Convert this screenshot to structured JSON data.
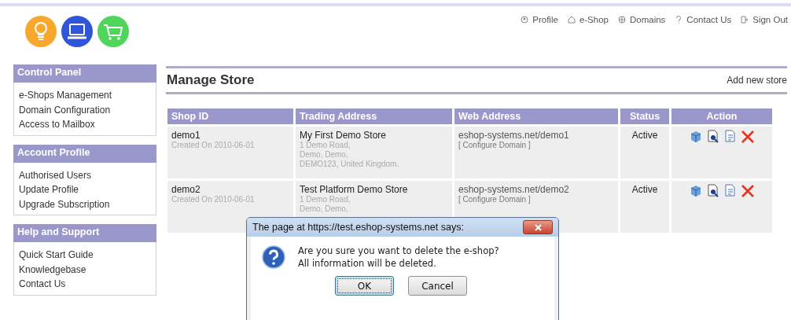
{
  "nav_links": [
    {
      "label": "Profile"
    },
    {
      "label": "e-Shop"
    },
    {
      "label": "Domains"
    },
    {
      "label": "Contact Us"
    },
    {
      "label": "Sign Out"
    }
  ],
  "sidebar": {
    "sections": [
      {
        "title": "Control Panel",
        "items": [
          "e-Shops Management",
          "Domain Configuration",
          "Access to Mailbox"
        ]
      },
      {
        "title": "Account Profile",
        "items": [
          "Authorised Users",
          "Update Profile",
          "Upgrade Subscription"
        ]
      },
      {
        "title": "Help and Support",
        "items": [
          "Quick Start Guide",
          "Knowledgebase",
          "Contact Us"
        ]
      }
    ]
  },
  "main": {
    "title": "Manage Store",
    "add_link": "Add new store",
    "table": {
      "columns": [
        "Shop ID",
        "Trading Address",
        "Web Address",
        "Status",
        "Action"
      ],
      "rows": [
        {
          "shop_id": "demo1",
          "created": "Created On 2010-06-01",
          "trading_name": "My First Demo Store",
          "address_lines": [
            "1 Demo Road,",
            "Demo, Demo,",
            "DEMO123, United Kingdom."
          ],
          "web_address": "eshop-systems.net/demo1",
          "configure_link": "[ Configure Domain ]",
          "status": "Active"
        },
        {
          "shop_id": "demo2",
          "created": "Created On 2010-06-01",
          "trading_name": "Test Platform Demo Store",
          "address_lines": [
            "1 Demo Road,",
            "Demo, Demo,"
          ],
          "web_address": "eshop-systems.net/demo2",
          "configure_link": "[ Configure Domain ]",
          "status": "Active"
        }
      ]
    }
  },
  "dialog": {
    "title": "The page at https://test.eshop-systems.net says:",
    "message_lines": [
      "Are you sure you want to delete the e-shop?",
      "All information will be deleted."
    ],
    "buttons": [
      {
        "label": "OK",
        "selected": true
      },
      {
        "label": "Cancel",
        "selected": false
      }
    ]
  }
}
